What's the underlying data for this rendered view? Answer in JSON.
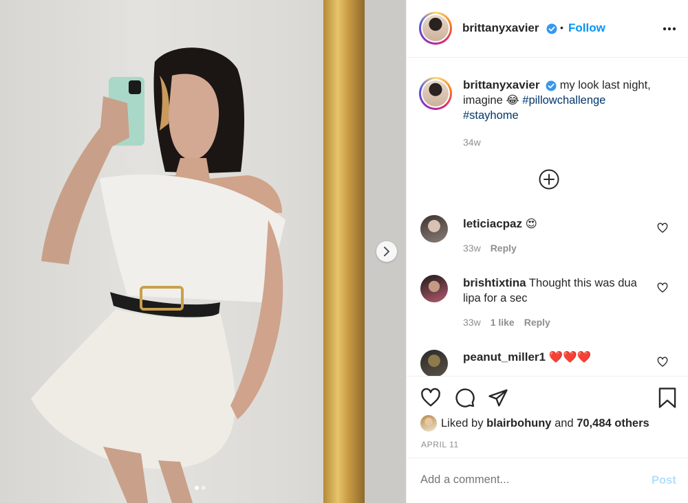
{
  "post": {
    "author": "brittanyxavier",
    "follow_separator": "•",
    "follow_label": "Follow",
    "more_icon": "more-horizontal-icon",
    "caption_body_before": "my look last night, imagine",
    "caption_emoji": "😂",
    "hashtags": [
      "#pillowchallenge",
      "#stayhome"
    ],
    "caption_age": "34w"
  },
  "comments": [
    {
      "user": "leticiacpaz",
      "text": "😍",
      "age": "33w",
      "likes": "",
      "reply_label": "Reply"
    },
    {
      "user": "brishtixtina",
      "text": "Thought this was dua lipa for a sec",
      "age": "33w",
      "likes": "1 like",
      "reply_label": "Reply"
    },
    {
      "user": "peanut_miller1",
      "text": "❤️❤️❤️",
      "age": "",
      "likes": "",
      "reply_label": ""
    }
  ],
  "engagement": {
    "liked_by_prefix": "Liked by",
    "liked_by_user": "blairbohuny",
    "liked_by_and": "and",
    "others_count": "70,484 others",
    "date": "APRIL 11"
  },
  "composer": {
    "placeholder": "Add a comment...",
    "post_label": "Post"
  },
  "carousel": {
    "current": 1,
    "total": 2
  },
  "colors": {
    "link": "#0095f6",
    "hashtag": "#00376b",
    "muted": "#8e8e8e",
    "post_disabled": "#b2dffc"
  }
}
